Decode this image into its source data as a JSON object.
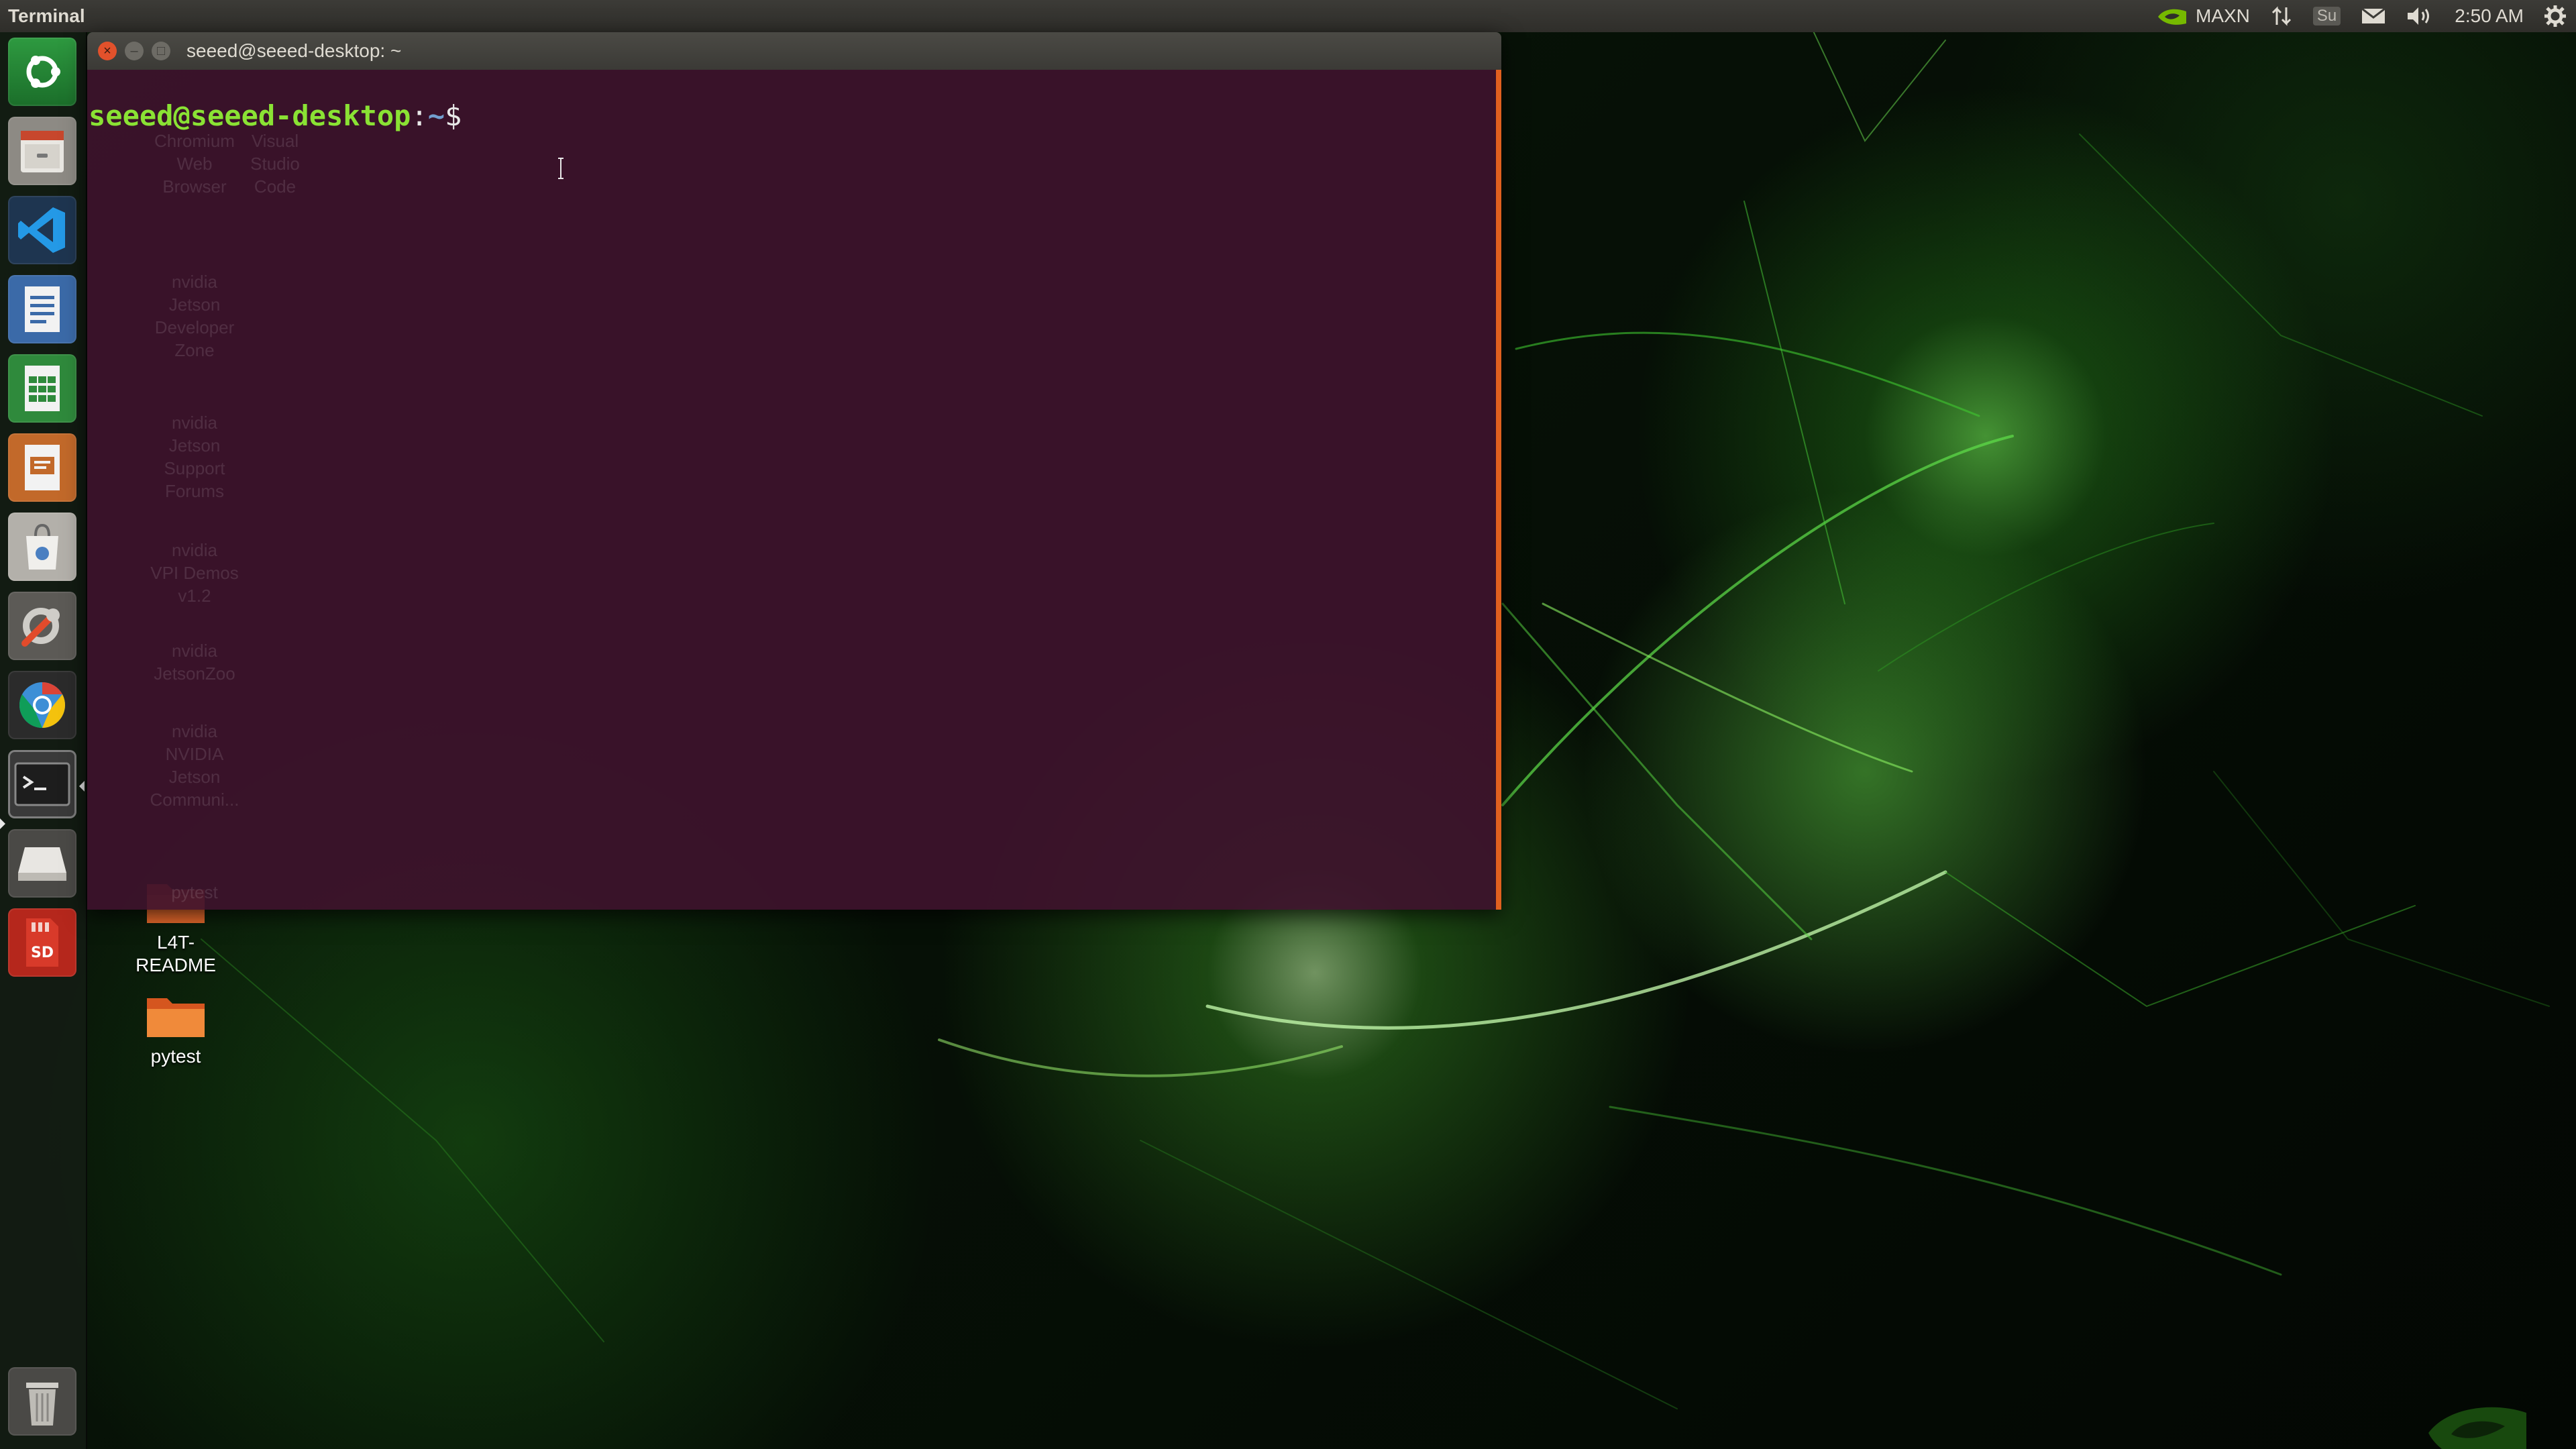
{
  "top_panel": {
    "app_title": "Terminal",
    "power_mode": "MAXN",
    "keyboard_indicator": "Su",
    "clock": "2:50 AM",
    "icons": [
      "nvidia-logo-icon",
      "network-icon",
      "keyboard-icon",
      "mail-icon",
      "volume-icon",
      "gear-icon"
    ]
  },
  "launcher": {
    "items": [
      {
        "name": "ubuntu-dash",
        "icon": "ubuntu-logo-icon"
      },
      {
        "name": "files",
        "icon": "file-cabinet-icon"
      },
      {
        "name": "vscode",
        "icon": "vscode-icon"
      },
      {
        "name": "writer",
        "icon": "document-icon"
      },
      {
        "name": "calc",
        "icon": "spreadsheet-icon"
      },
      {
        "name": "impress",
        "icon": "presentation-icon"
      },
      {
        "name": "software",
        "icon": "shopping-bag-icon"
      },
      {
        "name": "settings",
        "icon": "wrench-icon"
      },
      {
        "name": "chromium",
        "icon": "chromium-icon"
      },
      {
        "name": "terminal",
        "icon": "terminal-icon"
      },
      {
        "name": "drive",
        "icon": "drive-icon"
      },
      {
        "name": "sd-card",
        "icon": "sd-card-icon"
      },
      {
        "name": "trash",
        "icon": "trash-icon"
      }
    ]
  },
  "desktop": {
    "icons": [
      {
        "label_lines": [
          "L4T-",
          "README"
        ],
        "icon": "folder-icon"
      },
      {
        "label_lines": [
          "pytest"
        ],
        "icon": "folder-icon"
      }
    ],
    "ghost_labels": [
      "Chromium",
      "Web",
      "Browser",
      "Visual",
      "Studio",
      "Code",
      "nvidia",
      "Jetson",
      "Developer",
      "Zone",
      "nvidia",
      "Jetson",
      "Support",
      "Forums",
      "nvidia",
      "VPI Demos",
      "v1.2",
      "nvidia",
      "JetsonZoo",
      "nvidia",
      "NVIDIA",
      "Jetson",
      "Communi...",
      "pytest"
    ]
  },
  "terminal": {
    "title": "seeed@seeed-desktop: ~",
    "prompt_user": "seeed@seeed-desktop",
    "prompt_sep": ":",
    "prompt_path": "~",
    "prompt_symbol": "$",
    "colors": {
      "background": "#3e122c",
      "user": "#8ae234",
      "path": "#729fcf",
      "accent": "#e0601f"
    }
  }
}
